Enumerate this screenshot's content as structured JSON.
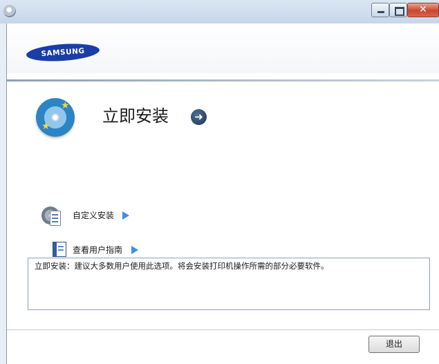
{
  "window": {
    "close_glyph": "✕",
    "accent_close": "#c9462c"
  },
  "header": {
    "logo_text": "SAMSUNG",
    "brand_color": "#1a3ea8"
  },
  "main": {
    "title": "立即安装",
    "title_arrow_icon": "arrow-right-circle-icon",
    "title_arrow_glyph": "➜"
  },
  "options": [
    {
      "label": "自定义安装",
      "icon": "custom-install-icon"
    },
    {
      "label": "查看用户指南",
      "icon": "user-guide-icon"
    }
  ],
  "description": {
    "text": "立即安装：建议大多数用户使用此选项。将会安装打印机操作所需的部分必要软件。"
  },
  "footer": {
    "exit_label": "退出"
  }
}
